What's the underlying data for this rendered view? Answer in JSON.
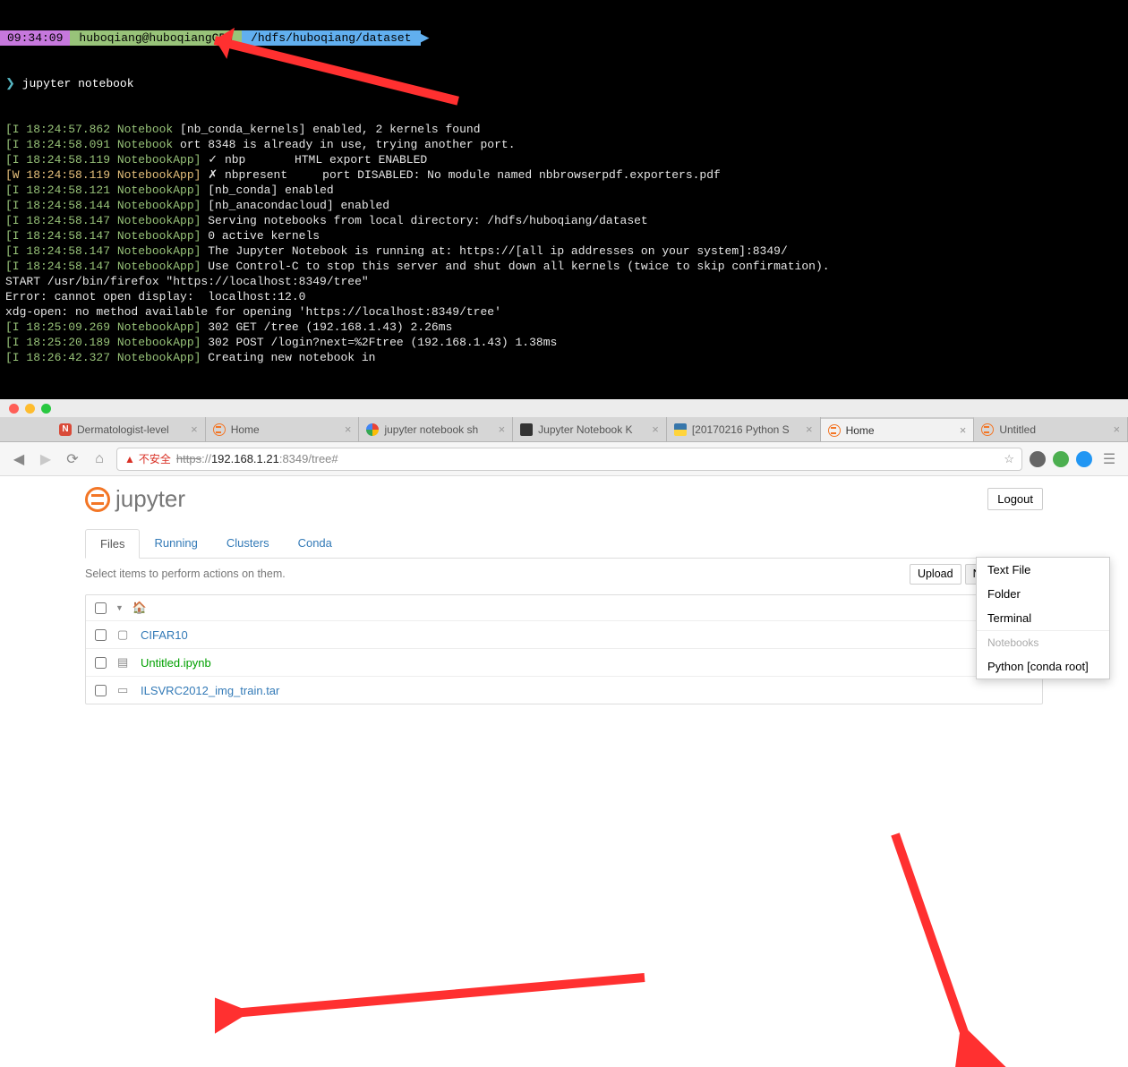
{
  "terminal": {
    "prompt": {
      "time": "09:34:09",
      "user": "huboqiang@huboqiangGPU",
      "path": "/hdfs/huboqiang/dataset"
    },
    "command": "jupyter notebook",
    "lines": [
      {
        "lvl": "I",
        "ts": "18:24:57.862",
        "src": "Notebook",
        "txt": "[nb_conda_kernels] enabled, 2 kernels found"
      },
      {
        "lvl": "I",
        "ts": "18:24:58.091",
        "src": "Notebook",
        "txt": "ort 8348 is already in use, trying another port."
      },
      {
        "lvl": "I",
        "ts": "18:24:58.119",
        "src": "NotebookApp]",
        "txt": "✓ nbp       HTML export ENABLED"
      },
      {
        "lvl": "W",
        "ts": "18:24:58.119",
        "src": "NotebookApp]",
        "txt": "✗ nbpresent     port DISABLED: No module named nbbrowserpdf.exporters.pdf"
      },
      {
        "lvl": "I",
        "ts": "18:24:58.121",
        "src": "NotebookApp]",
        "txt": "[nb_conda] enabled"
      },
      {
        "lvl": "I",
        "ts": "18:24:58.144",
        "src": "NotebookApp]",
        "txt": "[nb_anacondacloud] enabled"
      },
      {
        "lvl": "I",
        "ts": "18:24:58.147",
        "src": "NotebookApp]",
        "txt": "Serving notebooks from local directory: /hdfs/huboqiang/dataset"
      },
      {
        "lvl": "I",
        "ts": "18:24:58.147",
        "src": "NotebookApp]",
        "txt": "0 active kernels"
      },
      {
        "lvl": "I",
        "ts": "18:24:58.147",
        "src": "NotebookApp]",
        "txt": "The Jupyter Notebook is running at: https://[all ip addresses on your system]:8349/"
      },
      {
        "lvl": "I",
        "ts": "18:24:58.147",
        "src": "NotebookApp]",
        "txt": "Use Control-C to stop this server and shut down all kernels (twice to skip confirmation)."
      }
    ],
    "plain": [
      "START /usr/bin/firefox \"https://localhost:8349/tree\"",
      "Error: cannot open display:  localhost:12.0",
      "xdg-open: no method available for opening 'https://localhost:8349/tree'"
    ],
    "lines2": [
      {
        "lvl": "I",
        "ts": "18:25:09.269",
        "src": "NotebookApp]",
        "txt": "302 GET /tree (192.168.1.43) 2.26ms"
      },
      {
        "lvl": "I",
        "ts": "18:25:20.189",
        "src": "NotebookApp]",
        "txt": "302 POST /login?next=%2Ftree (192.168.1.43) 1.38ms"
      },
      {
        "lvl": "I",
        "ts": "18:26:42.327",
        "src": "NotebookApp]",
        "txt": "Creating new notebook in"
      }
    ]
  },
  "tabs": [
    {
      "fav": "N",
      "title": "Dermatologist-level"
    },
    {
      "fav": "j",
      "title": "Home"
    },
    {
      "fav": "G",
      "title": "jupyter notebook sh"
    },
    {
      "fav": "jn",
      "title": "Jupyter Notebook K"
    },
    {
      "fav": "py",
      "title": "[20170216 Python S"
    },
    {
      "fav": "j",
      "title": "Home",
      "active": true
    },
    {
      "fav": "j",
      "title": "Untitled"
    }
  ],
  "url": {
    "insecure": "不安全",
    "proto": "https",
    "host": "192.168.1.21",
    "port": ":8349",
    "path": "/tree#"
  },
  "jupyter": {
    "brand": "jupyter",
    "logout": "Logout",
    "tabs": [
      "Files",
      "Running",
      "Clusters",
      "Conda"
    ],
    "active_tab": 0,
    "select_text": "Select items to perform actions on them.",
    "upload": "Upload",
    "new": "New",
    "refresh": "⟳",
    "files": [
      {
        "icon": "📁",
        "name": "CIFAR10",
        "type": "dir"
      },
      {
        "icon": "📓",
        "name": "Untitled.ipynb",
        "type": "nb",
        "running": true
      },
      {
        "icon": "📄",
        "name": "ILSVRC2012_img_train.tar",
        "type": "file"
      }
    ],
    "dropdown": {
      "items": [
        "Text File",
        "Folder",
        "Terminal"
      ],
      "header": "Notebooks",
      "nb": [
        "Python [conda root]"
      ]
    }
  }
}
